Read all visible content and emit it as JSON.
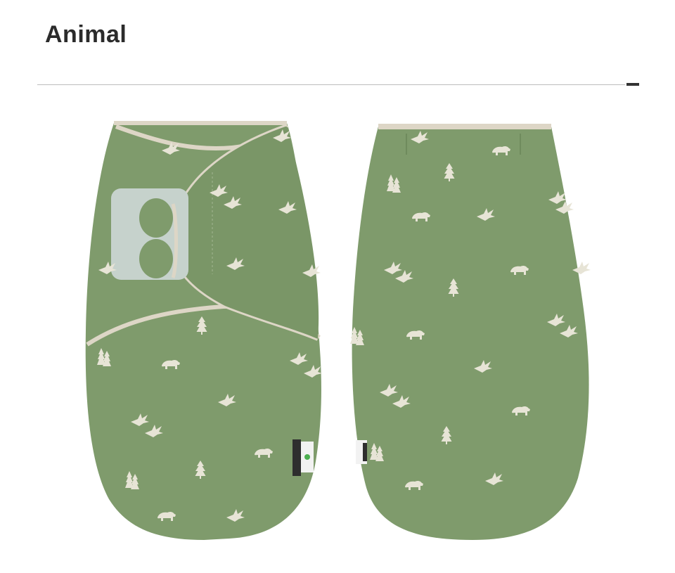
{
  "page": {
    "title": "Animal"
  },
  "colors": {
    "fabric": "#7f9b6c",
    "fabric_dark": "#6f8b5d",
    "trim": "#ddd6c6",
    "motif": "#e7e4d6",
    "velcro": "#c6d2cc",
    "label_dark": "#2e2e2e",
    "accent_line": "#333333"
  },
  "images": [
    {
      "name": "front-view",
      "description_icon": "swaddle-front-icon"
    },
    {
      "name": "back-view",
      "description_icon": "swaddle-back-icon"
    }
  ]
}
